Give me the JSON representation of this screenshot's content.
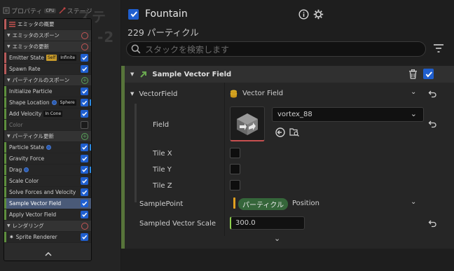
{
  "left_panel": {
    "tabs": [
      {
        "label": "プロパティ",
        "badge": "CPU"
      },
      {
        "label": "ステージ"
      }
    ],
    "bg_text": "ステム -2",
    "stack": [
      {
        "label": "エミッタの概要",
        "kind": "item",
        "icon": "list-icon"
      },
      {
        "label": "エミッタのスポーン",
        "kind": "header",
        "circle": "red"
      },
      {
        "label": "エミッタの更新",
        "kind": "header",
        "circle": "red"
      },
      {
        "label": "Emitter State",
        "kind": "item",
        "tags": [
          "Self",
          "Infinite"
        ],
        "tag_styles": [
          "yellow",
          "dark"
        ],
        "checked": true
      },
      {
        "label": "Spawn Rate",
        "kind": "item",
        "checked": true
      },
      {
        "label": "パーティクルのスポーン",
        "kind": "header",
        "circle": "green"
      },
      {
        "label": "Initialize Particle",
        "kind": "item",
        "checked": true
      },
      {
        "label": "Shape Location",
        "kind": "item",
        "dot": true,
        "tags": [
          "Sphere"
        ],
        "tag_styles": [
          "dark"
        ],
        "checked": true,
        "bluebar": true
      },
      {
        "label": "Add Velocity",
        "kind": "item",
        "tags": [
          "In Cone"
        ],
        "tag_styles": [
          "dark"
        ],
        "checked": true
      },
      {
        "label": "Color",
        "kind": "item",
        "checked": false,
        "dim": true
      },
      {
        "label": "パーティクル更新",
        "kind": "header",
        "circle": "green"
      },
      {
        "label": "Particle State",
        "kind": "item",
        "dot": true,
        "checked": true,
        "bluebar": true
      },
      {
        "label": "Gravity Force",
        "kind": "item",
        "checked": true
      },
      {
        "label": "Drag",
        "kind": "item",
        "dot": true,
        "checked": true,
        "bluebar": true
      },
      {
        "label": "Scale Color",
        "kind": "item",
        "checked": true
      },
      {
        "label": "Solve Forces and Velocity",
        "kind": "item",
        "checked": true
      },
      {
        "label": "Sample Vector Field",
        "kind": "item",
        "checked": true,
        "selected": true
      },
      {
        "label": "Apply Vector Field",
        "kind": "item",
        "checked": true
      },
      {
        "label": "レンダリング",
        "kind": "header",
        "circle": "red"
      },
      {
        "label": "Sprite Renderer",
        "kind": "item",
        "icon": "sprite-icon",
        "checked": true
      }
    ]
  },
  "right_panel": {
    "title": "Fountain",
    "subtitle": "229 パーティクル",
    "search_placeholder": "スタックを検索します",
    "section": {
      "title": "Sample Vector Field"
    },
    "rows": {
      "vector_field_label": "VectorField",
      "vector_field_value": "Vector Field",
      "field_label": "Field",
      "field_value": "vortex_88",
      "tile_x": "Tile X",
      "tile_y": "Tile Y",
      "tile_z": "Tile Z",
      "sample_point_label": "SamplePoint",
      "sample_point_pill": "パーティクル",
      "sample_point_value": "Position",
      "sampled_scale_label": "Sampled Vector Scale",
      "sampled_scale_value": "300.0"
    }
  },
  "colors": {
    "accent_blue": "#1f5fcf",
    "module_green": "#57743a",
    "header_red": "#c35555",
    "header_green": "#59a35a",
    "selection": "#4a5a78",
    "tag_yellow": "#c79a2a"
  }
}
